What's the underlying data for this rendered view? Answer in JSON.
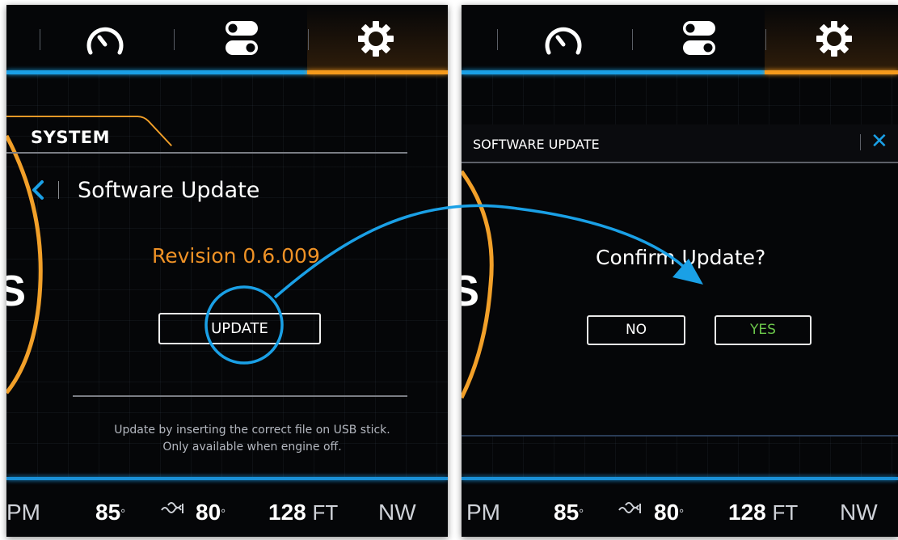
{
  "left_screen": {
    "nav": {
      "icons": [
        "speedometer-icon",
        "toggle-switches-icon",
        "gear-icon"
      ],
      "active_tab": "gear-icon"
    },
    "section_tab": "SYSTEM",
    "page_title": "Software Update",
    "revision": "Revision 0.6.009",
    "update_button": "UPDATE",
    "hint_line1": "Update by inserting the correct file on USB stick.",
    "hint_line2": "Only available when engine off.",
    "gauge_letter": "S"
  },
  "right_screen": {
    "dialog_title": "SOFTWARE UPDATE",
    "confirm_question": "Confirm Update?",
    "no_button": "NO",
    "yes_button": "YES",
    "close_icon": "close-icon",
    "gauge_letter": "S"
  },
  "status_bar": {
    "rpm_fragment": "PM",
    "temp1": "85",
    "temp1_unit": "°",
    "water_icon": "water-temp-icon",
    "temp2": "80",
    "temp2_unit": "°",
    "depth": "128",
    "depth_unit": "FT",
    "heading": "NW"
  },
  "colors": {
    "accent_blue": "#1aa0e6",
    "accent_orange": "#f59a1c",
    "yes_green": "#6cc84b",
    "background": "#050608"
  }
}
